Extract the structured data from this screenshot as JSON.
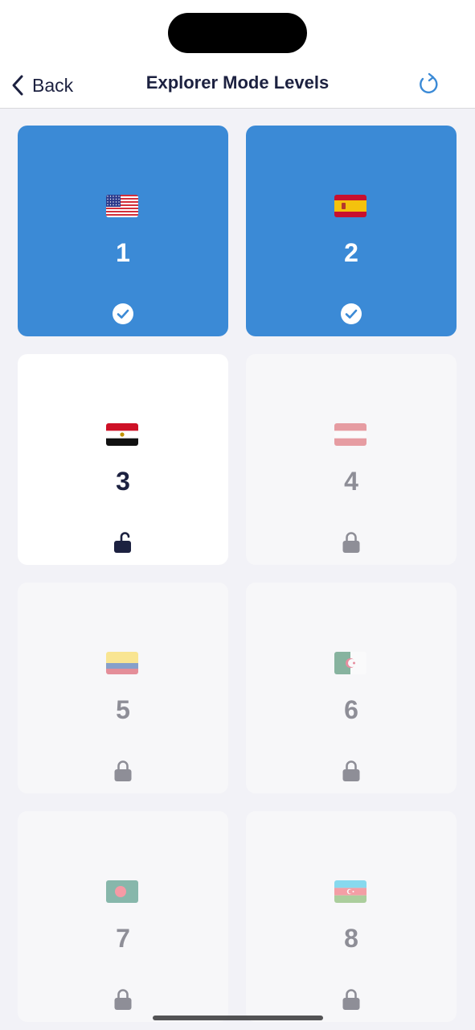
{
  "nav": {
    "back_label": "Back",
    "title": "Explorer Mode Levels",
    "refresh_icon": "refresh-icon",
    "back_icon": "chevron-left-icon"
  },
  "colors": {
    "accent": "#3b8ad6",
    "dark_text": "#1c2140",
    "muted_text": "#8e8e97"
  },
  "levels": [
    {
      "number": "1",
      "flag": "united-states-flag",
      "status": "completed"
    },
    {
      "number": "2",
      "flag": "spain-flag",
      "status": "completed"
    },
    {
      "number": "3",
      "flag": "egypt-flag",
      "status": "unlocked"
    },
    {
      "number": "4",
      "flag": "austria-flag",
      "status": "locked"
    },
    {
      "number": "5",
      "flag": "colombia-flag",
      "status": "locked"
    },
    {
      "number": "6",
      "flag": "algeria-flag",
      "status": "locked"
    },
    {
      "number": "7",
      "flag": "bangladesh-flag",
      "status": "locked"
    },
    {
      "number": "8",
      "flag": "azerbaijan-flag",
      "status": "locked"
    }
  ]
}
